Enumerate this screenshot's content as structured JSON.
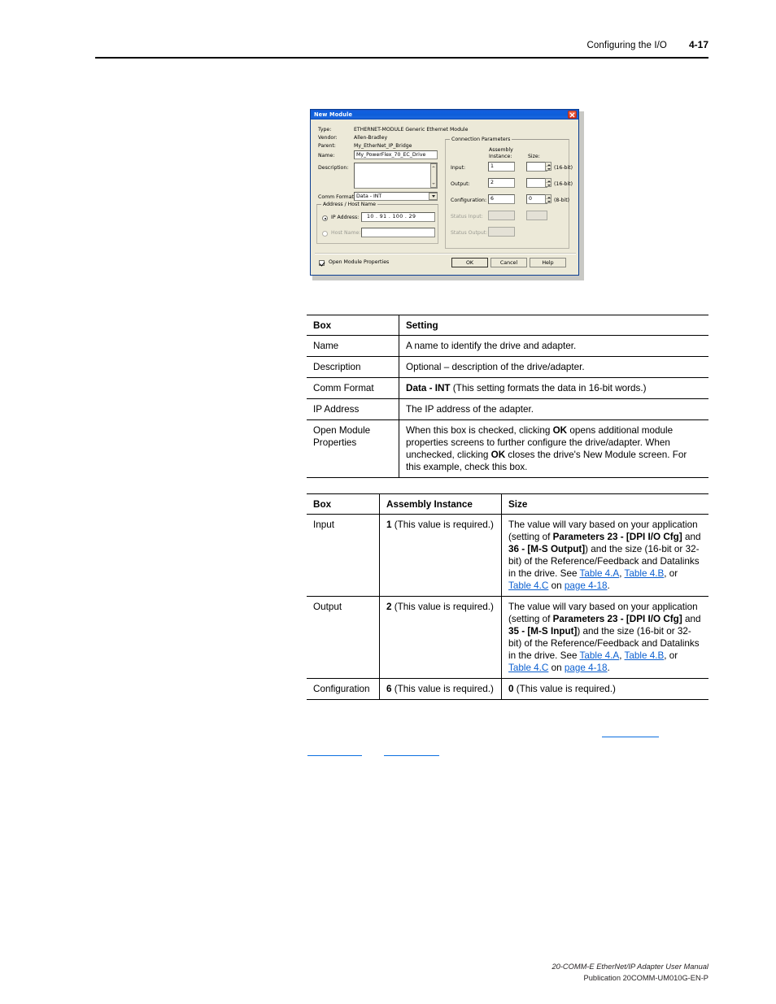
{
  "header": {
    "chapter": "Configuring the I/O",
    "page_number": "4-17"
  },
  "dialog": {
    "title": "New Module",
    "close_icon": "close-icon",
    "fields": {
      "type_label": "Type:",
      "type_value": "ETHERNET-MODULE Generic Ethernet Module",
      "vendor_label": "Vendor:",
      "vendor_value": "Allen-Bradley",
      "parent_label": "Parent:",
      "parent_value": "My_EtherNet_IP_Bridge",
      "name_label": "Name:",
      "name_value": "My_PowerFlex_70_EC_Drive",
      "description_label": "Description:",
      "description_value": "",
      "comm_format_label": "Comm Format:",
      "comm_format_value": "Data - INT"
    },
    "address_group": {
      "title": "Address / Host Name",
      "ip_label": "IP Address:",
      "ip_value": "10  .  91  .  100  .  29",
      "host_label": "Host Name:",
      "host_value": ""
    },
    "connection_group": {
      "title": "Connection Parameters",
      "col_assembly": "Assembly",
      "col_instance": "Instance:",
      "col_size": "Size:",
      "rows": [
        {
          "label": "Input:",
          "instance": "1",
          "size": "",
          "units": "(16-bit)"
        },
        {
          "label": "Output:",
          "instance": "2",
          "size": "",
          "units": "(16-bit)"
        },
        {
          "label": "Configuration:",
          "instance": "6",
          "size": "0",
          "units": "(8-bit)"
        },
        {
          "label": "Status Input:",
          "instance": "",
          "size": "",
          "units": ""
        },
        {
          "label": "Status Output:",
          "instance": "",
          "size": "",
          "units": ""
        }
      ]
    },
    "open_module_properties_label": "Open Module Properties",
    "buttons": {
      "ok": "OK",
      "cancel": "Cancel",
      "help": "Help"
    }
  },
  "table_settings": {
    "headers": [
      "Box",
      "Setting"
    ],
    "rows": [
      {
        "box": "Name",
        "setting_html": "A name to identify the drive and adapter."
      },
      {
        "box": "Description",
        "setting_html": "Optional – description of the drive/adapter."
      },
      {
        "box": "Comm Format",
        "setting_html": "<b>Data - INT</b> (This setting formats the data in 16-bit words.)"
      },
      {
        "box": "IP Address",
        "setting_html": "The IP address of the adapter."
      },
      {
        "box": "Open Module Properties",
        "setting_html": "When this box is checked, clicking <b>OK</b> opens additional module properties screens to further configure the drive/adapter. When unchecked, clicking <b>OK</b> closes the drive's New Module screen. For this example, check this box."
      }
    ]
  },
  "table_connection": {
    "headers": [
      "Box",
      "Assembly Instance",
      "Size"
    ],
    "rows": [
      {
        "box": "Input",
        "assembly_html": "<b>1</b> (This value is required.)",
        "size_html": "The value will vary based on your application (setting of <b>Parameters 23 - [DPI I/O Cfg]</b> and <b>36 - [M-S Output]</b>) and the size (16-bit or 32-bit) of the Reference/Feedback and Datalinks in the drive. See <span class=\"lnk\">Table 4.A</span>, <span class=\"lnk\">Table 4.B</span>, or <span class=\"lnk\">Table 4.C</span> on <span class=\"lnk\">page 4-18</span>."
      },
      {
        "box": "Output",
        "assembly_html": "<b>2</b> (This value is required.)",
        "size_html": "The value will vary based on your application (setting of <b>Parameters 23 - [DPI I/O Cfg]</b> and <b>35 - [M-S Input]</b>) and the size (16-bit or 32-bit) of the Reference/Feedback and Datalinks in the drive. See <span class=\"lnk\">Table 4.A</span>, <span class=\"lnk\">Table 4.B</span>, or <span class=\"lnk\">Table 4.C</span> on <span class=\"lnk\">page 4-18</span>."
      },
      {
        "box": "Configuration",
        "assembly_html": "<b>6</b> (This value is required.)",
        "size_html": "<b>0</b> (This value is required.)"
      }
    ]
  },
  "footer": {
    "line1": "20-COMM-E EtherNet/IP Adapter User Manual",
    "line2": "Publication 20COMM-UM010G-EN-P"
  },
  "colors": {
    "link": "#0b5fd0",
    "titlebar": "#0f5ed8",
    "dialog_face": "#ece9d8"
  }
}
